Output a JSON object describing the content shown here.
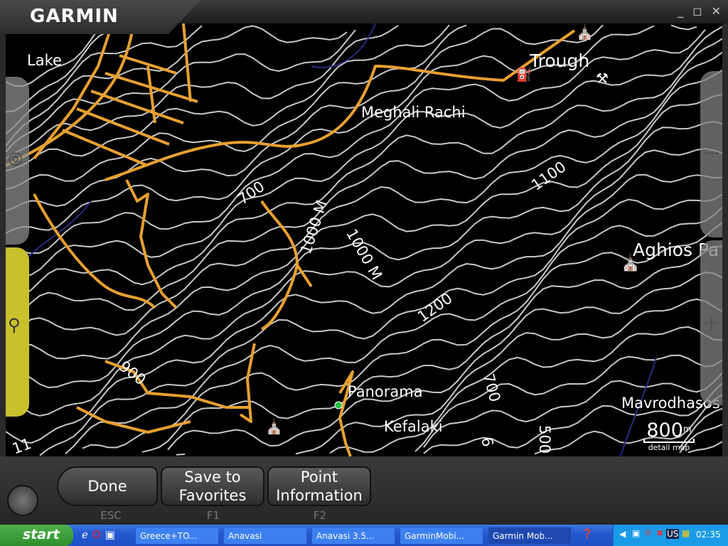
{
  "app": {
    "logo": "GARMIN",
    "window_controls": "_ ◻ ✕"
  },
  "map": {
    "labels": {
      "lake": "Lake",
      "trough": "Trough",
      "meghali_rachi": "Meghali Rachi",
      "aghios": "Aghios Pa",
      "panorama": "Panorama",
      "kefalaki": "Kefalaki",
      "mavrodhasos": "Mavrodhasos"
    },
    "contour_labels": {
      "c700a": "700",
      "c1000a": "1000 M",
      "c1000b": "1000 M",
      "c1100": "1100",
      "c1200": "1200",
      "c900": "900",
      "c700b": "700",
      "c500": "500",
      "c6": "6",
      "c11": "11"
    },
    "scale": {
      "value": "800",
      "unit": "m",
      "caption": "detail map"
    },
    "zoom_out": "−",
    "zoom_in": "+",
    "colors": {
      "road": "#e8a030",
      "contour": "#c8c8c8",
      "water": "#2a2a80"
    }
  },
  "buttons": {
    "done": "Done",
    "done_key": "ESC",
    "save": "Save to Favorites",
    "save_key": "F1",
    "point": "Point Information",
    "point_key": "F2"
  },
  "taskbar": {
    "start": "start",
    "tasks": [
      "Greece+TO...",
      "Anavasi",
      "Anavasi 3.5...",
      "GarminMobi...",
      "Garmin Mob..."
    ],
    "lang": "US",
    "clock": "02:35"
  }
}
